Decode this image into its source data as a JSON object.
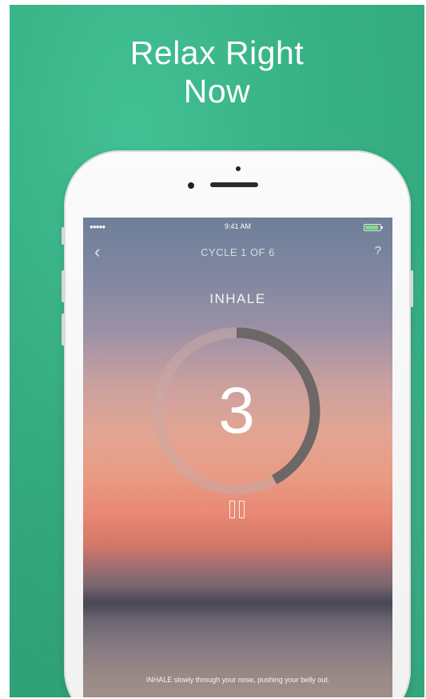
{
  "headline": {
    "line1": "Relax Right",
    "line2": "Now"
  },
  "statusbar": {
    "signal": "●●●●●",
    "time": "9:41 AM"
  },
  "navbar": {
    "back_icon": "‹",
    "title": "CYCLE 1 OF 6",
    "help_icon": "?"
  },
  "breathing": {
    "phase": "INHALE",
    "count": "3",
    "progress": 0.42,
    "instruction": "INHALE slowly through your nose, pushing your belly out."
  },
  "colors": {
    "promo_background": "#37b184",
    "ring_track": "#c9aaa6",
    "ring_progress": "#6d6866"
  }
}
